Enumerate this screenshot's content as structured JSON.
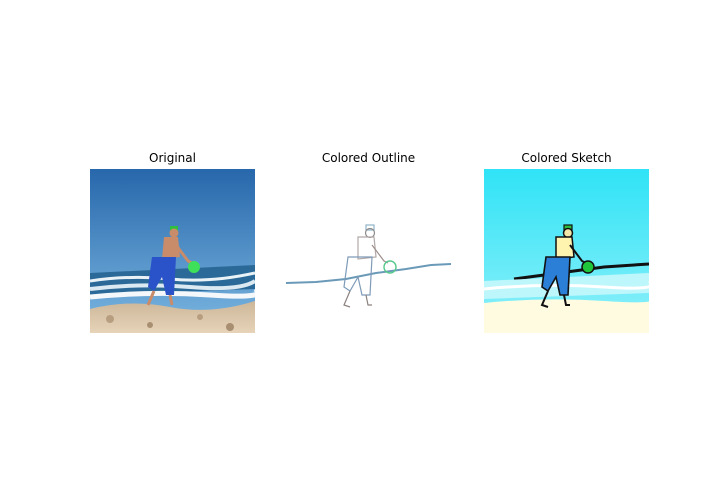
{
  "panels": [
    {
      "title": "Original"
    },
    {
      "title": "Colored Outline"
    },
    {
      "title": "Colored Sketch"
    }
  ],
  "colors": {
    "sky_top": "#2a6fb5",
    "sky_bottom": "#6fb2e0",
    "sea": "#1f5f8f",
    "sand": "#d8c2a6",
    "frisbee": "#3ee05a",
    "shorts": "#2a52c9",
    "skin": "#c98c6a",
    "cap": "#2fbf3f",
    "sketch_sky": "#2ee6f5",
    "sketch_sand": "#fffbe0",
    "outline_line": "#5b8fb0"
  }
}
